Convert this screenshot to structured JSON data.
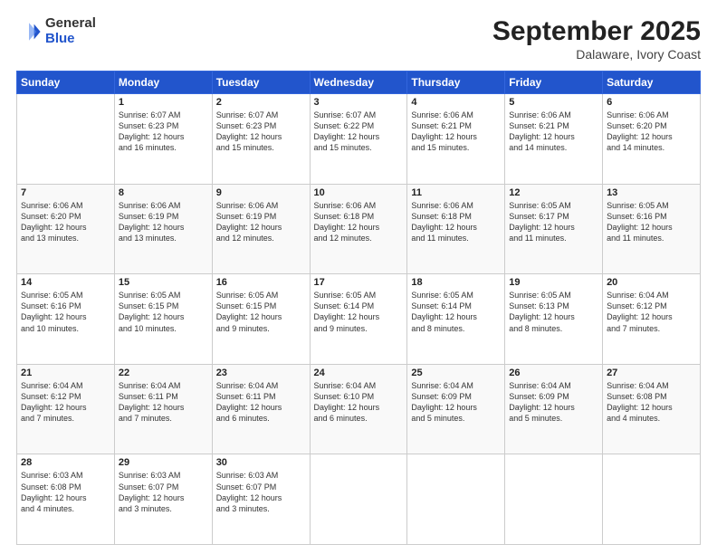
{
  "header": {
    "logo_general": "General",
    "logo_blue": "Blue",
    "month_title": "September 2025",
    "location": "Dalaware, Ivory Coast"
  },
  "days_of_week": [
    "Sunday",
    "Monday",
    "Tuesday",
    "Wednesday",
    "Thursday",
    "Friday",
    "Saturday"
  ],
  "weeks": [
    [
      {
        "num": "",
        "info": ""
      },
      {
        "num": "1",
        "info": "Sunrise: 6:07 AM\nSunset: 6:23 PM\nDaylight: 12 hours\nand 16 minutes."
      },
      {
        "num": "2",
        "info": "Sunrise: 6:07 AM\nSunset: 6:23 PM\nDaylight: 12 hours\nand 15 minutes."
      },
      {
        "num": "3",
        "info": "Sunrise: 6:07 AM\nSunset: 6:22 PM\nDaylight: 12 hours\nand 15 minutes."
      },
      {
        "num": "4",
        "info": "Sunrise: 6:06 AM\nSunset: 6:21 PM\nDaylight: 12 hours\nand 15 minutes."
      },
      {
        "num": "5",
        "info": "Sunrise: 6:06 AM\nSunset: 6:21 PM\nDaylight: 12 hours\nand 14 minutes."
      },
      {
        "num": "6",
        "info": "Sunrise: 6:06 AM\nSunset: 6:20 PM\nDaylight: 12 hours\nand 14 minutes."
      }
    ],
    [
      {
        "num": "7",
        "info": "Sunrise: 6:06 AM\nSunset: 6:20 PM\nDaylight: 12 hours\nand 13 minutes."
      },
      {
        "num": "8",
        "info": "Sunrise: 6:06 AM\nSunset: 6:19 PM\nDaylight: 12 hours\nand 13 minutes."
      },
      {
        "num": "9",
        "info": "Sunrise: 6:06 AM\nSunset: 6:19 PM\nDaylight: 12 hours\nand 12 minutes."
      },
      {
        "num": "10",
        "info": "Sunrise: 6:06 AM\nSunset: 6:18 PM\nDaylight: 12 hours\nand 12 minutes."
      },
      {
        "num": "11",
        "info": "Sunrise: 6:06 AM\nSunset: 6:18 PM\nDaylight: 12 hours\nand 11 minutes."
      },
      {
        "num": "12",
        "info": "Sunrise: 6:05 AM\nSunset: 6:17 PM\nDaylight: 12 hours\nand 11 minutes."
      },
      {
        "num": "13",
        "info": "Sunrise: 6:05 AM\nSunset: 6:16 PM\nDaylight: 12 hours\nand 11 minutes."
      }
    ],
    [
      {
        "num": "14",
        "info": "Sunrise: 6:05 AM\nSunset: 6:16 PM\nDaylight: 12 hours\nand 10 minutes."
      },
      {
        "num": "15",
        "info": "Sunrise: 6:05 AM\nSunset: 6:15 PM\nDaylight: 12 hours\nand 10 minutes."
      },
      {
        "num": "16",
        "info": "Sunrise: 6:05 AM\nSunset: 6:15 PM\nDaylight: 12 hours\nand 9 minutes."
      },
      {
        "num": "17",
        "info": "Sunrise: 6:05 AM\nSunset: 6:14 PM\nDaylight: 12 hours\nand 9 minutes."
      },
      {
        "num": "18",
        "info": "Sunrise: 6:05 AM\nSunset: 6:14 PM\nDaylight: 12 hours\nand 8 minutes."
      },
      {
        "num": "19",
        "info": "Sunrise: 6:05 AM\nSunset: 6:13 PM\nDaylight: 12 hours\nand 8 minutes."
      },
      {
        "num": "20",
        "info": "Sunrise: 6:04 AM\nSunset: 6:12 PM\nDaylight: 12 hours\nand 7 minutes."
      }
    ],
    [
      {
        "num": "21",
        "info": "Sunrise: 6:04 AM\nSunset: 6:12 PM\nDaylight: 12 hours\nand 7 minutes."
      },
      {
        "num": "22",
        "info": "Sunrise: 6:04 AM\nSunset: 6:11 PM\nDaylight: 12 hours\nand 7 minutes."
      },
      {
        "num": "23",
        "info": "Sunrise: 6:04 AM\nSunset: 6:11 PM\nDaylight: 12 hours\nand 6 minutes."
      },
      {
        "num": "24",
        "info": "Sunrise: 6:04 AM\nSunset: 6:10 PM\nDaylight: 12 hours\nand 6 minutes."
      },
      {
        "num": "25",
        "info": "Sunrise: 6:04 AM\nSunset: 6:09 PM\nDaylight: 12 hours\nand 5 minutes."
      },
      {
        "num": "26",
        "info": "Sunrise: 6:04 AM\nSunset: 6:09 PM\nDaylight: 12 hours\nand 5 minutes."
      },
      {
        "num": "27",
        "info": "Sunrise: 6:04 AM\nSunset: 6:08 PM\nDaylight: 12 hours\nand 4 minutes."
      }
    ],
    [
      {
        "num": "28",
        "info": "Sunrise: 6:03 AM\nSunset: 6:08 PM\nDaylight: 12 hours\nand 4 minutes."
      },
      {
        "num": "29",
        "info": "Sunrise: 6:03 AM\nSunset: 6:07 PM\nDaylight: 12 hours\nand 3 minutes."
      },
      {
        "num": "30",
        "info": "Sunrise: 6:03 AM\nSunset: 6:07 PM\nDaylight: 12 hours\nand 3 minutes."
      },
      {
        "num": "",
        "info": ""
      },
      {
        "num": "",
        "info": ""
      },
      {
        "num": "",
        "info": ""
      },
      {
        "num": "",
        "info": ""
      }
    ]
  ]
}
